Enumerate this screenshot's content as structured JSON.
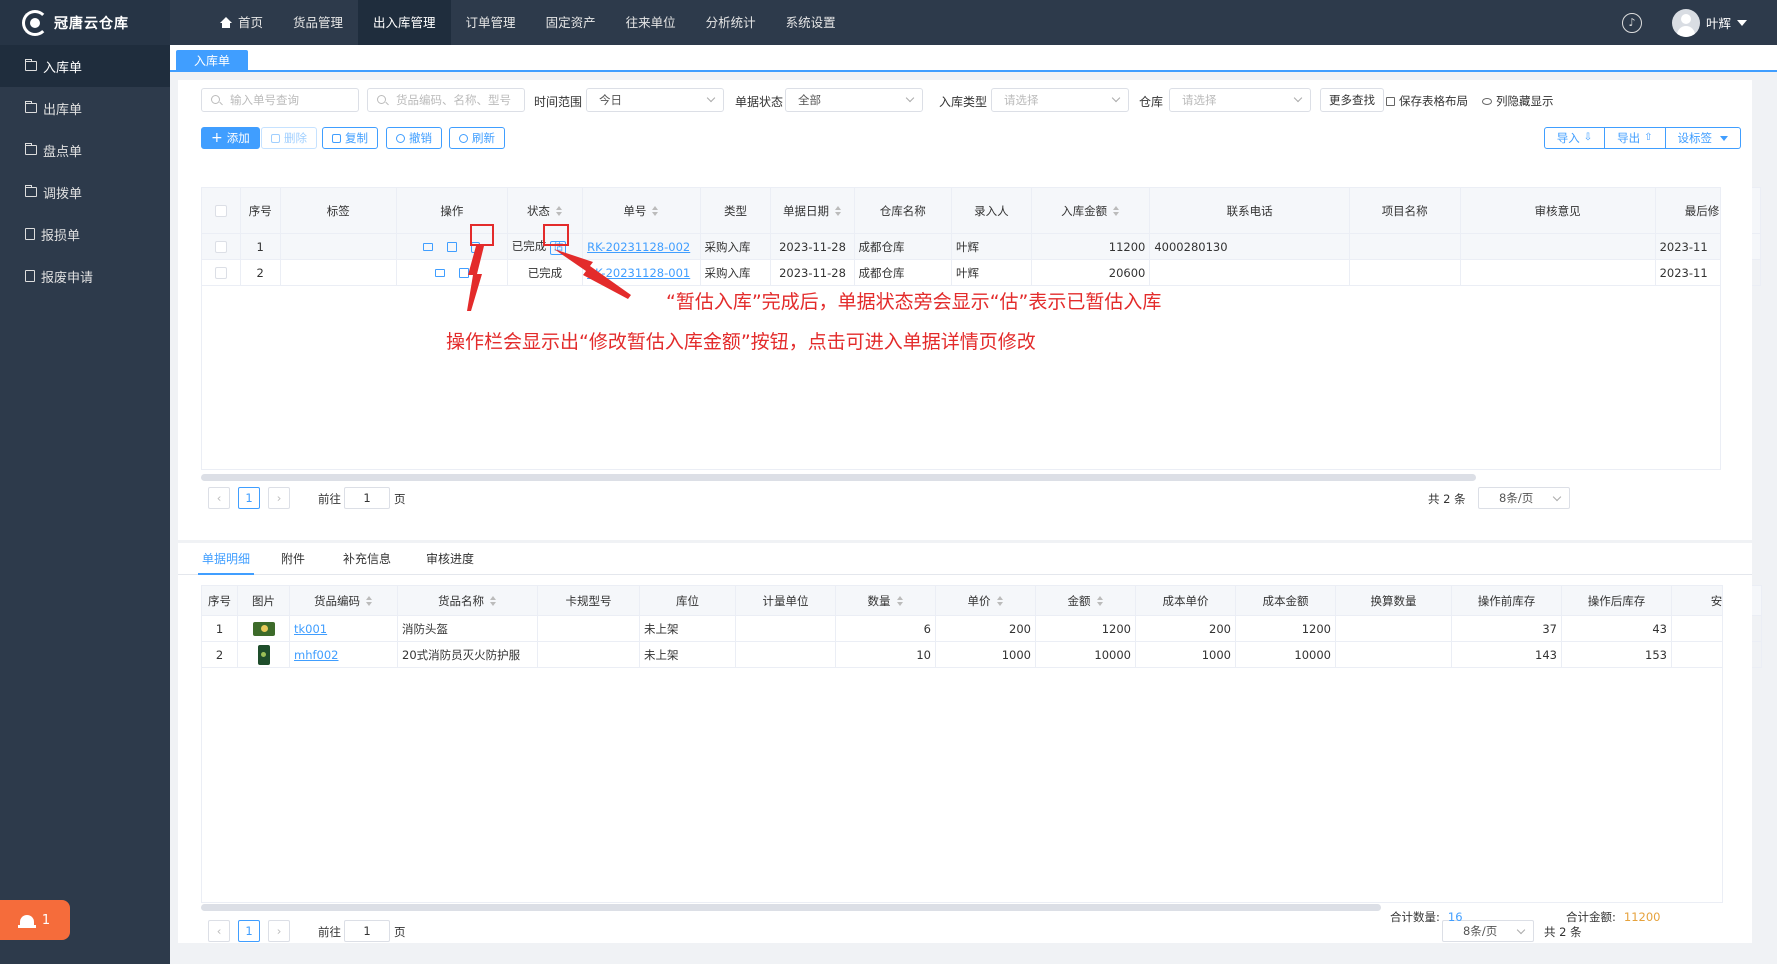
{
  "app": {
    "logo_text": "冠唐云仓库",
    "user_name": "叶辉"
  },
  "nav": [
    "首页",
    "货品管理",
    "出入库管理",
    "订单管理",
    "固定资产",
    "往来单位",
    "分析统计",
    "系统设置"
  ],
  "sidebar": [
    "入库单",
    "出库单",
    "盘点单",
    "调拨单",
    "报损单",
    "报废申请"
  ],
  "alarm_count": "1",
  "page_tab": "入库单",
  "filters": {
    "order_no_placeholder": "输入单号查询",
    "goods_placeholder": "货品编码、名称、型号",
    "time_label": "时间范围",
    "time_value": "今日",
    "status_label": "单据状态",
    "status_value": "全部",
    "type_label": "入库类型",
    "type_placeholder": "请选择",
    "warehouse_label": "仓库",
    "warehouse_placeholder": "请选择",
    "more_search": "更多查找",
    "save_layout": "保存表格布局",
    "hidden_cols": "列隐藏显示"
  },
  "toolbar": {
    "add": "添加",
    "delete": "删除",
    "copy": "复制",
    "revoke": "撤销",
    "refresh": "刷新",
    "import": "导入",
    "export": "导出",
    "settings": "设标签"
  },
  "main_table": {
    "headers": [
      "序号",
      "标签",
      "操作",
      "状态",
      "单号",
      "类型",
      "单据日期",
      "仓库名称",
      "录入人",
      "入库金额",
      "联系电话",
      "项目名称",
      "审核意见",
      "最后修改"
    ],
    "rows": [
      {
        "no": "1",
        "tag": "",
        "status": "已完成",
        "est_badge": "估",
        "order_no": "RK-20231128-002",
        "type": "采购入库",
        "date": "2023-11-28",
        "warehouse": "成都仓库",
        "operator": "叶辉",
        "amount": "11200",
        "phone": "4000280130",
        "project": "",
        "review": "",
        "last_modified": "2023-11"
      },
      {
        "no": "2",
        "tag": "",
        "status": "已完成",
        "est_badge": "",
        "order_no": "RK-20231128-001",
        "type": "采购入库",
        "date": "2023-11-28",
        "warehouse": "成都仓库",
        "operator": "叶辉",
        "amount": "20600",
        "phone": "",
        "project": "",
        "review": "",
        "last_modified": "2023-11"
      }
    ]
  },
  "pager1": {
    "page": "1",
    "goto_label": "前往",
    "goto_value": "1",
    "page_unit": "页",
    "total": "共 2 条",
    "page_size": "8条/页"
  },
  "annotations": {
    "text1": "“暂估入库”完成后，单据状态旁会显示“估”表示已暂估入库",
    "text2": "操作栏会显示出“修改暂估入库金额”按钮，点击可进入单据详情页修改"
  },
  "detail_tabs": [
    "单据明细",
    "附件",
    "补充信息",
    "审核进度"
  ],
  "detail_table": {
    "headers": [
      "序号",
      "图片",
      "货品编码",
      "货品名称",
      "卡规型号",
      "库位",
      "计量单位",
      "数量",
      "单价",
      "金额",
      "成本单价",
      "成本金额",
      "换算数量",
      "操作前库存",
      "操作后库存",
      "安"
    ],
    "rows": [
      {
        "no": "1",
        "code": "tk001",
        "name": "消防头盔",
        "model": "",
        "location": "未上架",
        "unit": "",
        "qty": "6",
        "price": "200",
        "amount": "1200",
        "cost_price": "200",
        "cost_amount": "1200",
        "conv_qty": "",
        "stock_before": "37",
        "stock_after": "43"
      },
      {
        "no": "2",
        "code": "mhf002",
        "name": "20式消防员灭火防护服",
        "model": "",
        "location": "未上架",
        "unit": "",
        "qty": "10",
        "price": "1000",
        "amount": "10000",
        "cost_price": "1000",
        "cost_amount": "10000",
        "conv_qty": "",
        "stock_before": "143",
        "stock_after": "153"
      }
    ]
  },
  "pager2": {
    "page": "1",
    "goto_label": "前往",
    "goto_value": "1",
    "page_unit": "页",
    "total": "共 2 条",
    "page_size": "8条/页"
  },
  "totals": {
    "qty_label": "合计数量:",
    "qty_value": "16",
    "amount_label": "合计金额:",
    "amount_value": "11200"
  },
  "colors": {
    "primary": "#409eff",
    "sidebar": "#2d3a4b",
    "annotation": "#e32b2b",
    "alarm": "#f56c3b"
  }
}
